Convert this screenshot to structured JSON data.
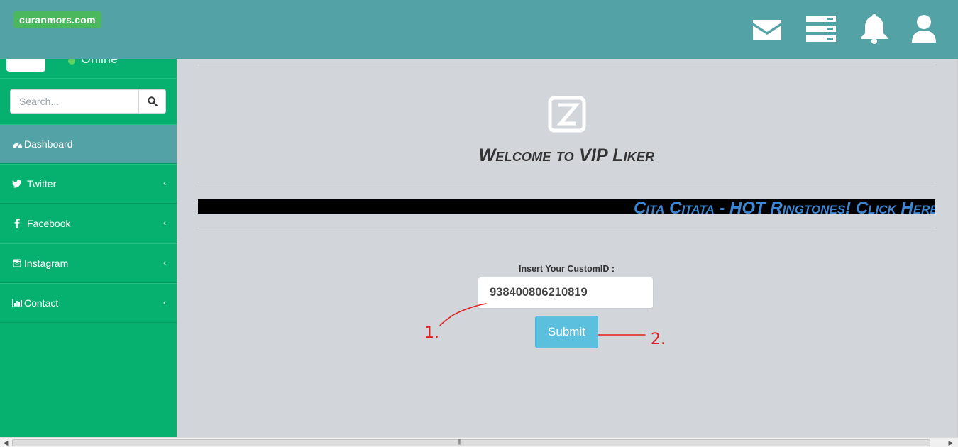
{
  "header": {
    "brand": "curanmors.com",
    "icons": [
      "envelope-icon",
      "server-icon",
      "bell-icon",
      "user-icon"
    ]
  },
  "sidebar": {
    "status_text": "Online",
    "search_placeholder": "Search...",
    "items": [
      {
        "label": "Dashboard",
        "icon": "dashboard-icon"
      },
      {
        "label": "Twitter",
        "icon": "twitter-icon"
      },
      {
        "label": "Facebook",
        "icon": "facebook-icon"
      },
      {
        "label": "Instagram",
        "icon": "instagram-icon"
      },
      {
        "label": "Contact",
        "icon": "bar-chart-icon"
      }
    ]
  },
  "main": {
    "welcome": "Welcome to VIP Liker",
    "marquee": "Cita Citata - HOT Ringtones! Click Here",
    "form_label": "Insert Your CustomID :",
    "custom_id_value": "938400806210819",
    "submit_label": "Submit"
  },
  "annotations": [
    "1.",
    "2."
  ],
  "colors": {
    "header": "#53a2a5",
    "sidebar": "#06b16f",
    "brand_badge": "#4cb85e",
    "submit": "#5bc0de",
    "marquee_text": "#3f86d2",
    "annotation": "#e02020"
  }
}
